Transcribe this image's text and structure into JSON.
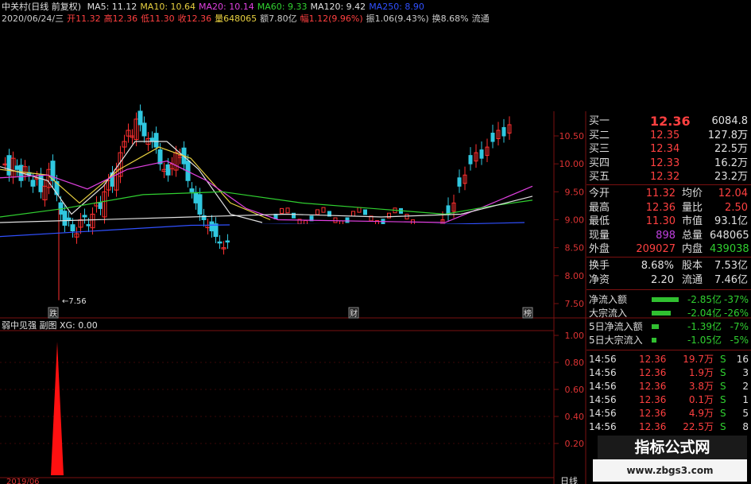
{
  "header": {
    "stock": "中关村(日线 前复权)",
    "ma": [
      {
        "label": "MA5: 11.12",
        "color": "#e0e0e0"
      },
      {
        "label": "MA10: 10.64",
        "color": "#e8d040"
      },
      {
        "label": "MA20: 10.14",
        "color": "#e040e0"
      },
      {
        "label": "MA60: 9.33",
        "color": "#30d030"
      },
      {
        "label": "MA120: 9.42",
        "color": "#e0e0e0"
      },
      {
        "label": "MA250: 8.90",
        "color": "#3050ff"
      }
    ],
    "quote": [
      {
        "label": "2020/06/24/三",
        "color": "#ccc"
      },
      {
        "label": "开11.32",
        "color": "#ff4040"
      },
      {
        "label": "高12.36",
        "color": "#ff4040"
      },
      {
        "label": "低11.30",
        "color": "#ff4040"
      },
      {
        "label": "收12.36",
        "color": "#ff4040"
      },
      {
        "label": "量648065",
        "color": "#e8d040"
      },
      {
        "label": "额7.80亿",
        "color": "#ccc"
      },
      {
        "label": "幅1.12(9.96%)",
        "color": "#ff4040"
      },
      {
        "label": "振1.06(9.43%)",
        "color": "#ccc"
      },
      {
        "label": "换8.68%",
        "color": "#ccc"
      },
      {
        "label": "流通",
        "color": "#ccc"
      }
    ]
  },
  "price_axis": [
    "10.50",
    "10.00",
    "9.50",
    "9.00",
    "8.50",
    "8.00",
    "7.50"
  ],
  "low_marker": "←7.56",
  "event_tags": {
    "left": "跌",
    "mid": "财",
    "right": "榜"
  },
  "sub_chart": {
    "title": "弱中见强 副图",
    "xg": "XG: 0.00",
    "axis": [
      "1.00",
      "0.80",
      "0.60",
      "0.40",
      "0.20"
    ],
    "date_left": "2019/06",
    "right_label": "日线"
  },
  "order_book": {
    "asks": [
      {
        "label": "买一",
        "price": "12.36",
        "vol": "6084.8万"
      },
      {
        "label": "买二",
        "price": "12.35",
        "vol": "127.8万"
      },
      {
        "label": "买三",
        "price": "12.34",
        "vol": "22.5万"
      },
      {
        "label": "买四",
        "price": "12.33",
        "vol": "16.2万"
      },
      {
        "label": "买五",
        "price": "12.32",
        "vol": "23.2万"
      }
    ]
  },
  "stats": [
    {
      "l1": "今开",
      "v1": "11.32",
      "l2": "均价",
      "v2": "12.04"
    },
    {
      "l1": "最高",
      "v1": "12.36",
      "l2": "量比",
      "v2": "2.50"
    },
    {
      "l1": "最低",
      "v1": "11.30",
      "l2": "市值",
      "v2": "93.1亿"
    },
    {
      "l1": "现量",
      "v1": "898",
      "l2": "总量",
      "v2": "648065"
    },
    {
      "l1": "外盘",
      "v1": "209027",
      "l2": "内盘",
      "v2": "439038"
    }
  ],
  "stats2": [
    {
      "l1": "换手",
      "v1": "8.68%",
      "l2": "股本",
      "v2": "7.53亿"
    },
    {
      "l1": "净资",
      "v1": "2.20",
      "l2": "流通",
      "v2": "7.46亿"
    }
  ],
  "flows": [
    {
      "label": "净流入额",
      "value": "-2.85亿",
      "pct": "-37%",
      "bar": 1.0
    },
    {
      "label": "大宗流入",
      "value": "-2.04亿",
      "pct": "-26%",
      "bar": 0.7
    },
    {
      "label": "5日净流入额",
      "value": "-1.39亿",
      "pct": "-7%",
      "bar": 0.25
    },
    {
      "label": "5日大宗流入",
      "value": "-1.05亿",
      "pct": "-5%",
      "bar": 0.18
    }
  ],
  "ticks": [
    {
      "time": "14:56",
      "price": "12.36",
      "vol": "19.7万",
      "side": "S",
      "n": "16"
    },
    {
      "time": "14:56",
      "price": "12.36",
      "vol": "1.9万",
      "side": "S",
      "n": "3"
    },
    {
      "time": "14:56",
      "price": "12.36",
      "vol": "3.8万",
      "side": "S",
      "n": "2"
    },
    {
      "time": "14:56",
      "price": "12.36",
      "vol": "0.1万",
      "side": "S",
      "n": "1"
    },
    {
      "time": "14:56",
      "price": "12.36",
      "vol": "4.9万",
      "side": "S",
      "n": "5"
    },
    {
      "time": "14:56",
      "price": "12.36",
      "vol": "22.5万",
      "side": "S",
      "n": "8"
    }
  ],
  "watermark": {
    "title": "指标公式网",
    "url": "www.zbgs3.com"
  },
  "colors": {
    "up": "#ff3030",
    "down": "#30c8e0",
    "grid": "#7a1010"
  }
}
